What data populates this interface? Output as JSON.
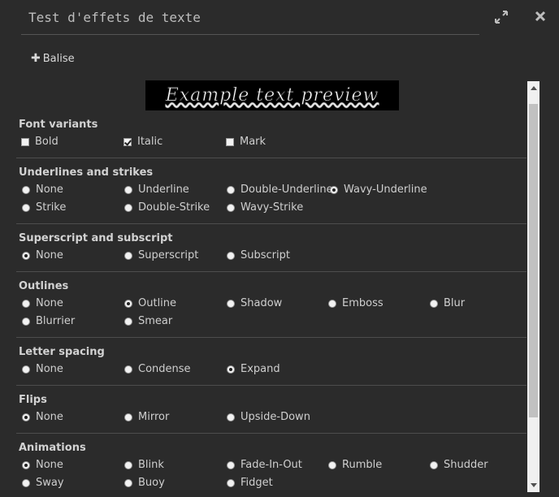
{
  "dialog": {
    "title": "Test d'effets de texte"
  },
  "toolbar": {
    "tag_label": "Balise"
  },
  "preview": {
    "text": "Example text preview"
  },
  "sections": {
    "font_variants": {
      "title": "Font variants",
      "options": [
        {
          "label": "Bold",
          "checked": false
        },
        {
          "label": "Italic",
          "checked": true
        },
        {
          "label": "Mark",
          "checked": false
        }
      ]
    },
    "underlines": {
      "title": "Underlines and strikes",
      "options": [
        {
          "label": "None",
          "selected": false
        },
        {
          "label": "Underline",
          "selected": false
        },
        {
          "label": "Double-Underline",
          "selected": false
        },
        {
          "label": "Wavy-Underline",
          "selected": true
        },
        {
          "label": "Strike",
          "selected": false
        },
        {
          "label": "Double-Strike",
          "selected": false
        },
        {
          "label": "Wavy-Strike",
          "selected": false
        }
      ]
    },
    "superscript": {
      "title": "Superscript and subscript",
      "options": [
        {
          "label": "None",
          "selected": true
        },
        {
          "label": "Superscript",
          "selected": false
        },
        {
          "label": "Subscript",
          "selected": false
        }
      ]
    },
    "outlines": {
      "title": "Outlines",
      "options": [
        {
          "label": "None",
          "selected": false
        },
        {
          "label": "Outline",
          "selected": true
        },
        {
          "label": "Shadow",
          "selected": false
        },
        {
          "label": "Emboss",
          "selected": false
        },
        {
          "label": "Blur",
          "selected": false
        },
        {
          "label": "Blurrier",
          "selected": false
        },
        {
          "label": "Smear",
          "selected": false
        }
      ]
    },
    "letter_spacing": {
      "title": "Letter spacing",
      "options": [
        {
          "label": "None",
          "selected": false
        },
        {
          "label": "Condense",
          "selected": false
        },
        {
          "label": "Expand",
          "selected": true
        }
      ]
    },
    "flips": {
      "title": "Flips",
      "options": [
        {
          "label": "None",
          "selected": true
        },
        {
          "label": "Mirror",
          "selected": false
        },
        {
          "label": "Upside-Down",
          "selected": false
        }
      ]
    },
    "animations": {
      "title": "Animations",
      "options": [
        {
          "label": "None",
          "selected": true
        },
        {
          "label": "Blink",
          "selected": false
        },
        {
          "label": "Fade-In-Out",
          "selected": false
        },
        {
          "label": "Rumble",
          "selected": false
        },
        {
          "label": "Shudder",
          "selected": false
        },
        {
          "label": "Sway",
          "selected": false
        },
        {
          "label": "Buoy",
          "selected": false
        },
        {
          "label": "Fidget",
          "selected": false
        }
      ]
    }
  },
  "icons": {
    "expand": "expand-icon",
    "close": "close-icon",
    "plus": "plus-icon"
  }
}
